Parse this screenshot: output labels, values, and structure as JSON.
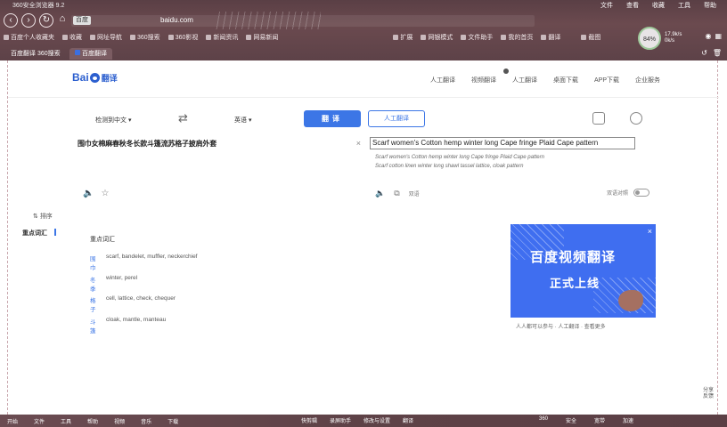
{
  "browser": {
    "title": "360安全浏览器 9.2",
    "menu": [
      "文件",
      "查看",
      "收藏",
      "工具",
      "帮助"
    ],
    "address_badge": "百度",
    "address_url": "baidu.com",
    "favorites": [
      "百度个人收藏夹",
      "收藏",
      "网址导航",
      "360搜索",
      "360影视",
      "新闻资讯",
      "网易新闻",
      "扩展",
      "网银模式",
      "文件助手",
      "我的首页",
      "翻译",
      "截图"
    ],
    "zoom": "84%",
    "net_up": "17.9k/s",
    "net_down": "0k/s",
    "tabs": [
      "百度翻译 360搜索",
      "百度翻译"
    ]
  },
  "header": {
    "logo_text": "Bai",
    "logo_suffix": "翻译",
    "nav": [
      "人工翻译",
      "视频翻译",
      "人工翻译",
      "桌面下载",
      "APP下载",
      "企业服务"
    ]
  },
  "controls": {
    "source_lang": "检测到中文",
    "swap": "⇄",
    "target_lang": "英语",
    "translate_btn": "翻译",
    "human_btn": "人工翻译"
  },
  "source": {
    "text": "围巾女棉麻春秋冬长款斗篷流苏格子披肩外套",
    "clear": "×"
  },
  "target": {
    "main": "Scarf women's Cotton hemp winter long Cape fringe Plaid Cape pattern",
    "alt1": "Scarf women's Cotton hemp winter long Cape fringe Plaid Cape pattern",
    "alt2": "Scarf cotton linen winter long shawl tassel lattice, cloak pattern",
    "tools_label": "双语",
    "toggle_label": "双语对照"
  },
  "sidebar": {
    "sort": "排序",
    "vocab": "重点词汇"
  },
  "vocab": {
    "title": "重点词汇",
    "rows": [
      {
        "word": "围巾",
        "meaning": "scarf, bandelet, muffler, neckerchief"
      },
      {
        "word": "冬季",
        "meaning": "winter, perel"
      },
      {
        "word": "格子",
        "meaning": "cell, lattice, check, chequer"
      },
      {
        "word": "斗篷",
        "meaning": "cloak, mantle, manteau"
      }
    ]
  },
  "ad": {
    "title": "百度视频翻译",
    "subtitle": "正式上线",
    "close": "×",
    "caption": "人人都可以参与 · 人工翻译 · 查看更多"
  },
  "right_float": [
    "分享",
    "反馈"
  ],
  "taskbar": {
    "left": [
      "开始",
      "文件",
      "工具",
      "帮助",
      "视频",
      "音乐",
      "下载"
    ],
    "mid": [
      "快剪辑",
      "录屏助手",
      "修改与设置",
      "翻译"
    ],
    "right": [
      "360",
      "安全",
      "宽带",
      "加速"
    ]
  }
}
